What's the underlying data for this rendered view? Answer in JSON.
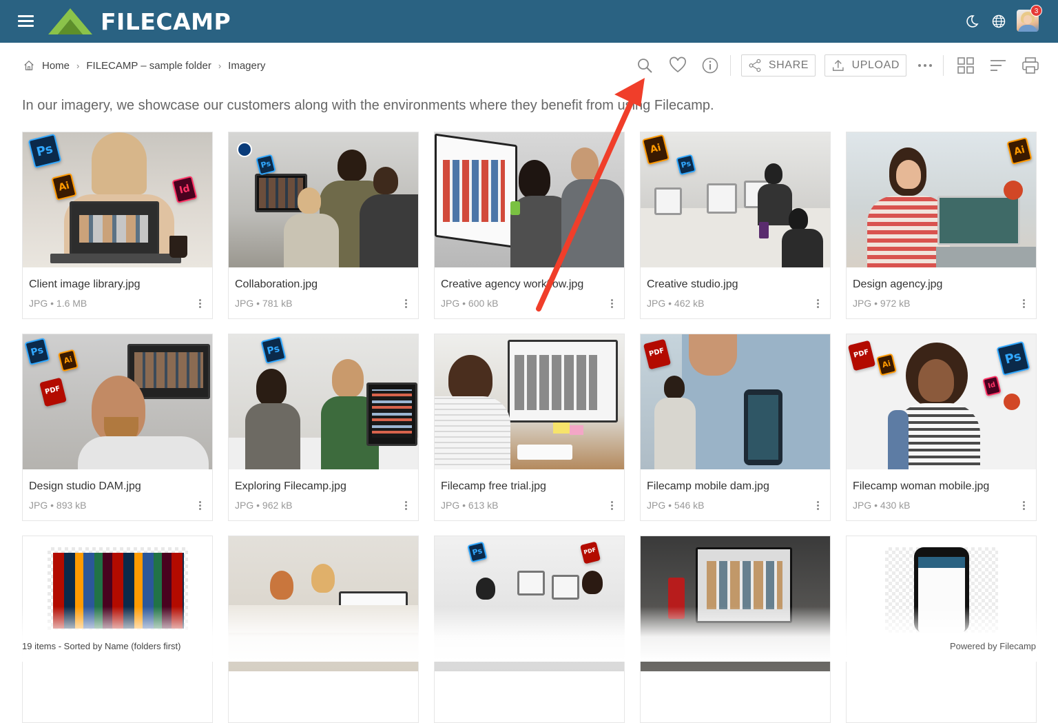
{
  "header": {
    "brand": "FILECAMP",
    "notification_count": "3",
    "icons": [
      "menu-icon",
      "moon-icon",
      "globe-icon",
      "avatar"
    ]
  },
  "breadcrumb": [
    "Home",
    "FILECAMP – sample folder",
    "Imagery"
  ],
  "toolbar": {
    "share_label": "SHARE",
    "upload_label": "UPLOAD",
    "icons": [
      "search-icon",
      "heart-icon",
      "info-icon",
      "share-icon",
      "upload-icon",
      "more-icon",
      "grid-view-icon",
      "sort-icon",
      "print-icon"
    ]
  },
  "description": "In our imagery, we showcase our customers along with the environments where they benefit from using Filecamp.",
  "files": [
    {
      "name": "Client image library.jpg",
      "meta": "JPG • 1.6 MB"
    },
    {
      "name": "Collaboration.jpg",
      "meta": "JPG • 781 kB"
    },
    {
      "name": "Creative agency workflow.jpg",
      "meta": "JPG • 600 kB"
    },
    {
      "name": "Creative studio.jpg",
      "meta": "JPG • 462 kB"
    },
    {
      "name": "Design agency.jpg",
      "meta": "JPG • 972 kB"
    },
    {
      "name": "Design studio DAM.jpg",
      "meta": "JPG • 893 kB"
    },
    {
      "name": "Exploring Filecamp.jpg",
      "meta": "JPG • 962 kB"
    },
    {
      "name": "Filecamp free trial.jpg",
      "meta": "JPG • 613 kB"
    },
    {
      "name": "Filecamp mobile dam.jpg",
      "meta": "JPG • 546 kB"
    },
    {
      "name": "Filecamp woman mobile.jpg",
      "meta": "JPG • 430 kB"
    }
  ],
  "status_text": "19 items - Sorted by Name (folders first)",
  "footer_text": "Powered by Filecamp",
  "colors": {
    "header": "#2a6282",
    "logo_green": "#8bc34a",
    "arrow": "#f03e2a"
  }
}
